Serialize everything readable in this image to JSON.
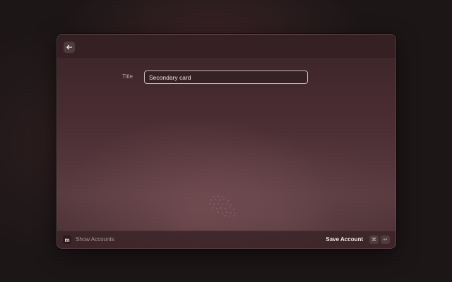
{
  "header": {
    "back_icon": "arrow-left-icon"
  },
  "form": {
    "title_label": "Title",
    "title_value": "Secondary card"
  },
  "footer": {
    "app_icon_letter": "m",
    "show_accounts_label": "Show Accounts",
    "save_label": "Save Account",
    "shortcut_keys": [
      "⌘",
      "↩"
    ]
  },
  "colors": {
    "background": "#1c1617",
    "window_top": "#3b2428",
    "window_bottom": "#5a3c41",
    "input_border": "#cbb8ba"
  }
}
